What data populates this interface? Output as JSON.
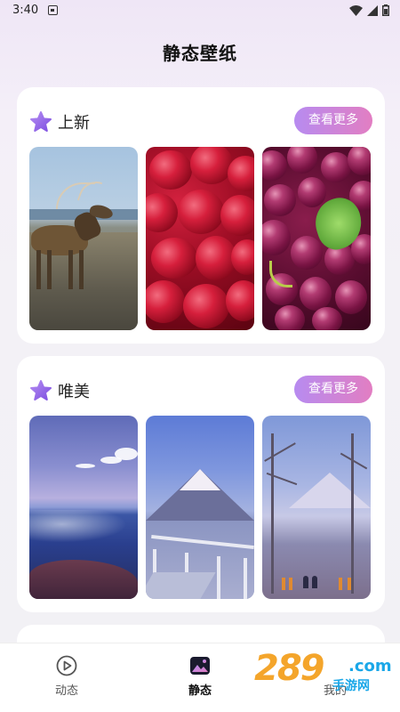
{
  "status_bar": {
    "time": "3:40"
  },
  "page": {
    "title": "静态壁纸"
  },
  "sections": [
    {
      "title": "上新",
      "more_label": "查看更多"
    },
    {
      "title": "唯美",
      "more_label": "查看更多"
    },
    {
      "title": "",
      "more_label": ""
    }
  ],
  "tab_bar": {
    "tabs": [
      {
        "label": "动态"
      },
      {
        "label": "静态"
      },
      {
        "label": "我的"
      }
    ],
    "active": "静态"
  },
  "watermark": {
    "number": "289",
    "suffix": ".com",
    "sub": "手游网"
  },
  "colors": {
    "accent_start": "#b78bf0",
    "accent_end": "#e27ec2",
    "star": "#8f63e8"
  }
}
